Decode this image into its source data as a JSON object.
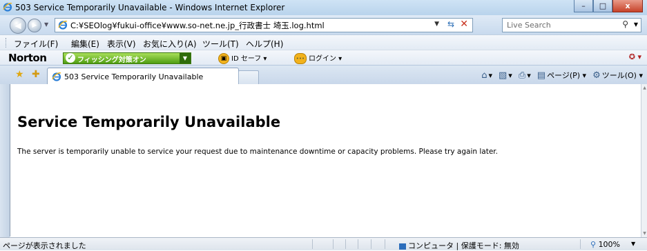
{
  "window": {
    "title": "503 Service Temporarily Unavailable - Windows Internet Explorer",
    "min_glyph": "–",
    "max_glyph": "□",
    "close_glyph": "x"
  },
  "addressbar": {
    "url": "C:¥SEOlog¥fukui-office¥www.so-net.ne.jp_行政書士 埼玉.log.html"
  },
  "search": {
    "placeholder": "Live Search"
  },
  "menu": {
    "items": [
      "ファイル(F)",
      "編集(E)",
      "表示(V)",
      "お気に入り(A)",
      "ツール(T)",
      "ヘルプ(H)"
    ]
  },
  "norton": {
    "logo": "Norton",
    "phishing_label": "フィッシング対策オン",
    "idsafe_label": "ID セーフ ▾",
    "login_label": "ログイン ▾",
    "idsafe_badge": "▣",
    "login_badge": "•••"
  },
  "tab": {
    "label": "503 Service Temporarily Unavailable"
  },
  "commandbar": {
    "home": "▾",
    "feeds": "▾",
    "print": "▾",
    "page_label": "ページ(P) ▾",
    "tools_label": "ツール(O) ▾"
  },
  "page": {
    "heading": "Service Temporarily Unavailable",
    "message": "The server is temporarily unable to service your request due to maintenance downtime or capacity problems. Please try again later."
  },
  "status": {
    "text": "ページが表示されました",
    "zone": "コンピュータ | 保護モード: 無効",
    "zoom": "100%"
  },
  "colors": {
    "phishing_green": "#4f9d12",
    "close_red": "#c7432a",
    "link_blue": "#2b6dbb"
  }
}
